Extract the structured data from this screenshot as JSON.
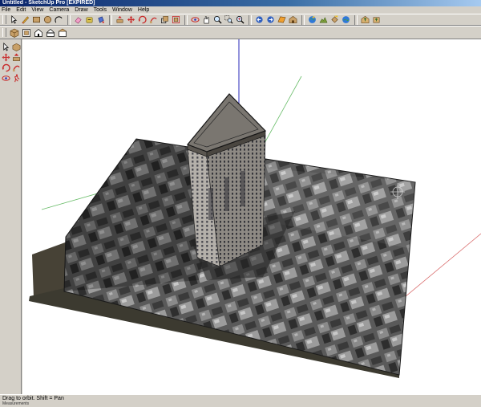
{
  "window": {
    "title": "Untitled - SketchUp Pro [EXPIRED]"
  },
  "menu": [
    "File",
    "Edit",
    "View",
    "Camera",
    "Draw",
    "Tools",
    "Window",
    "Help"
  ],
  "status": {
    "hint": "Drag to orbit.  Shift = Pan",
    "measurement_fragment": "Measurements"
  },
  "colors": {
    "menu_bar": "#d4d0c8",
    "title_gradient_start": "#0a246a",
    "viewport_background": "#ffffff",
    "blue_axis": "#2a2ab8",
    "green_axis": "#2aa02a",
    "red_axis": "#c82a2a"
  }
}
